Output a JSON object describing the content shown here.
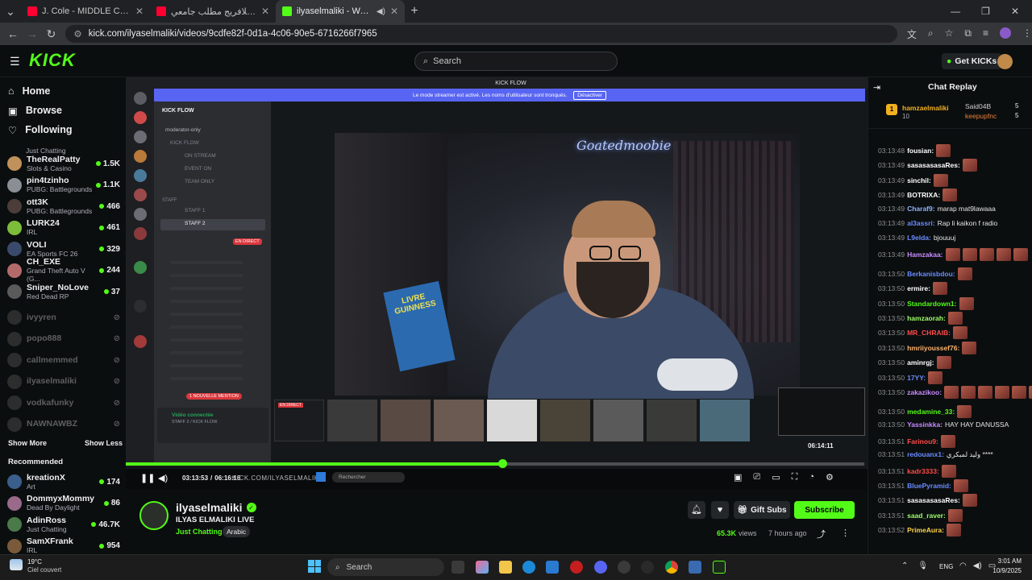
{
  "browser": {
    "tabs": [
      {
        "title": "J. Cole - MIDDLE CHILD (Official",
        "color": "#ff0033"
      },
      {
        "title": "لهذا عمر بلافريج مطلب جامعي |",
        "color": "#ff0033"
      },
      {
        "title": "ilyaselmaliki - Watch the V",
        "color": "#53fc18"
      }
    ],
    "url": "kick.com/ilyaselmaliki/videos/9cdfe82f-0d1a-4c06-90e5-6716266f7965"
  },
  "header": {
    "logo": "KICK",
    "search_placeholder": "Search",
    "get_kicks": "Get KICKs"
  },
  "sidebar": {
    "nav": [
      "Home",
      "Browse",
      "Following"
    ],
    "following_partial_cat": "Just Chatting",
    "following": [
      {
        "name": "TheRealPatty",
        "cat": "Slots & Casino",
        "viewers": "1.5K",
        "color": "#c0915a"
      },
      {
        "name": "pin4tzinho",
        "cat": "PUBG: Battlegrounds",
        "viewers": "1.1K",
        "color": "#8a8f96"
      },
      {
        "name": "ott3K",
        "cat": "PUBG: Battlegrounds",
        "viewers": "466",
        "color": "#4a3d3a"
      },
      {
        "name": "LURK24",
        "cat": "IRL",
        "viewers": "461",
        "color": "#7cbe3a"
      },
      {
        "name": "VOLI",
        "cat": "EA Sports FC 26",
        "viewers": "329",
        "color": "#3a4a6a"
      },
      {
        "name": "CH_EXE",
        "cat": "Grand Theft Auto V (G...",
        "viewers": "244",
        "color": "#b56a6a"
      },
      {
        "name": "Sniper_NoLove",
        "cat": "Red Dead RP",
        "viewers": "37",
        "color": "#5a5a5a"
      }
    ],
    "offline": [
      "ivyyren",
      "popo888",
      "callmemmed",
      "ilyaselmaliki",
      "vodkafunky",
      "NAWNAWBZ"
    ],
    "show_more": "Show More",
    "show_less": "Show Less",
    "recommended_title": "Recommended",
    "recommended": [
      {
        "name": "kreationX",
        "cat": "Art",
        "viewers": "174",
        "color": "#3a5f8a"
      },
      {
        "name": "DommyxMommy",
        "cat": "Dead By Daylight",
        "viewers": "86",
        "color": "#9a6a8a"
      },
      {
        "name": "AdinRoss",
        "cat": "Just Chatting",
        "viewers": "46.7K",
        "color": "#4a7a4a"
      },
      {
        "name": "SamXFrank",
        "cat": "IRL",
        "viewers": "954",
        "color": "#7a5a3a"
      }
    ]
  },
  "video": {
    "inner_app_title": "KICK FLOW",
    "banner_text": "Le mode streamer est activé. Les noms d'utilisateur sont tronqués.",
    "banner_button": "Désactiver",
    "server_name": "KICK FLOW",
    "channels": [
      "moderator-only",
      "KICK FLOW",
      "ON STREAM",
      "EVENT ON",
      "TEAM ONLY"
    ],
    "staff_header": "STAFF",
    "staff_channels": [
      "STAFF 1",
      "STAFF 2"
    ],
    "live_badge": "EN DIRECT",
    "voice_connected": "Vidéo connectée",
    "voice_sub": "STAFF 2 / KICK FLOW",
    "mention_badge": "1 NOUVELLE MENTION",
    "neon_sign": "Goatedmoobie",
    "book_title": "LIVRE GUINNESS",
    "thumb_time": "06:14:11",
    "current_time": "03:13:53",
    "total_time": "06:16:16",
    "watermark": "KICK.COM/ILYASELMALIKI",
    "progress": 0.51,
    "taskbar_search": "Rechercher"
  },
  "channel": {
    "name": "ilyaselmaliki",
    "title": "ILYAS ELMALIKI LIVE",
    "category": "Just Chatting",
    "tag": "Arabic",
    "views": "65.3K",
    "views_label": "views",
    "ago": "7 hours ago",
    "gift_subs": "Gift Subs",
    "subscribe": "Subscribe"
  },
  "chat": {
    "title": "Chat Replay",
    "gifters": [
      {
        "name": "hamzaelmaliki",
        "count": "10"
      },
      {
        "name": "Said04B",
        "count": "5"
      },
      {
        "name": "keepupfnc",
        "count": "5"
      }
    ],
    "messages": [
      {
        "time": "03:13:48",
        "user": "fousian:",
        "color": "#ffffff",
        "text": "",
        "emotes": 1
      },
      {
        "time": "03:13:49",
        "user": "sasasasasaRes:",
        "color": "#ffffff",
        "text": "",
        "emotes": 1
      },
      {
        "time": "03:13:49",
        "user": "sinchil:",
        "color": "#ffffff",
        "text": "",
        "emotes": 1
      },
      {
        "time": "03:13:49",
        "user": "BOTRIXA:",
        "color": "#ffffff",
        "text": "",
        "emotes": 1
      },
      {
        "time": "03:13:49",
        "user": "Charaf9:",
        "color": "#8fb3ff",
        "text": "marap mat9lawaaa",
        "emotes": 0
      },
      {
        "time": "03:13:49",
        "user": "al3assri:",
        "color": "#6a8cff",
        "text": "Rap li kaikon f radio",
        "emotes": 0
      },
      {
        "time": "03:13:49",
        "user": "L9elda:",
        "color": "#6a8cff",
        "text": "bjouuuj",
        "emotes": 0
      },
      {
        "time": "03:13:49",
        "user": "Hamzakaa:",
        "color": "#c98bff",
        "text": "",
        "emotes": 5
      },
      {
        "time": "03:13:50",
        "user": "Berkanisbdou:",
        "color": "#6a8cff",
        "text": "",
        "emotes": 1
      },
      {
        "time": "03:13:50",
        "user": "ermire:",
        "color": "#ffffff",
        "text": "",
        "emotes": 1
      },
      {
        "time": "03:13:50",
        "user": "Standardown1:",
        "color": "#53fc18",
        "text": "",
        "emotes": 1
      },
      {
        "time": "03:13:50",
        "user": "hamzaorah:",
        "color": "#9cff6a",
        "text": "",
        "emotes": 1
      },
      {
        "time": "03:13:50",
        "user": "MR_CHRAIB:",
        "color": "#ff4a4a",
        "text": "",
        "emotes": 1
      },
      {
        "time": "03:13:50",
        "user": "hmriiyoussef76:",
        "color": "#ffb36a",
        "text": "",
        "emotes": 1
      },
      {
        "time": "03:13:50",
        "user": "aminrgj:",
        "color": "#ffffff",
        "text": "",
        "emotes": 1
      },
      {
        "time": "03:13:50",
        "user": "17YY:",
        "color": "#6a8cff",
        "text": "",
        "emotes": 1
      },
      {
        "time": "03:13:50",
        "user": "zakazikoo:",
        "color": "#c98bff",
        "text": "",
        "emotes": 7
      },
      {
        "time": "03:13:50",
        "user": "medamine_33:",
        "color": "#53fc18",
        "text": "",
        "emotes": 1
      },
      {
        "time": "03:13:50",
        "user": "Yassinkka:",
        "color": "#c98bff",
        "text": "HAY HAY DANUSSA",
        "emotes": 0
      },
      {
        "time": "03:13:51",
        "user": "Farinou9:",
        "color": "#ff4a4a",
        "text": "",
        "emotes": 1
      },
      {
        "time": "03:13:51",
        "user": "redouanx1:",
        "color": "#6a8cff",
        "text": "وليد لمبكري ****",
        "emotes": 0
      },
      {
        "time": "03:13:51",
        "user": "kadr3333:",
        "color": "#ff4a4a",
        "text": "",
        "emotes": 1
      },
      {
        "time": "03:13:51",
        "user": "BluePyramid:",
        "color": "#6a8cff",
        "text": "",
        "emotes": 1
      },
      {
        "time": "03:13:51",
        "user": "sasasasasaRes:",
        "color": "#ffffff",
        "text": "",
        "emotes": 1
      },
      {
        "time": "03:13:51",
        "user": "saad_raver:",
        "color": "#9cff6a",
        "text": "",
        "emotes": 1
      },
      {
        "time": "03:13:52",
        "user": "PrimeAura:",
        "color": "#ffd24a",
        "text": "",
        "emotes": 1
      }
    ]
  },
  "taskbar": {
    "weather_temp": "19°C",
    "weather_desc": "Ciel couvert",
    "search": "Search",
    "lang": "ENG",
    "time": "3:01 AM",
    "date": "10/9/2025"
  },
  "colors": {
    "accent": "#53fc18",
    "bg": "#0b0e0f",
    "discord_bg": "#2b2d31",
    "banner": "#5865f2"
  }
}
